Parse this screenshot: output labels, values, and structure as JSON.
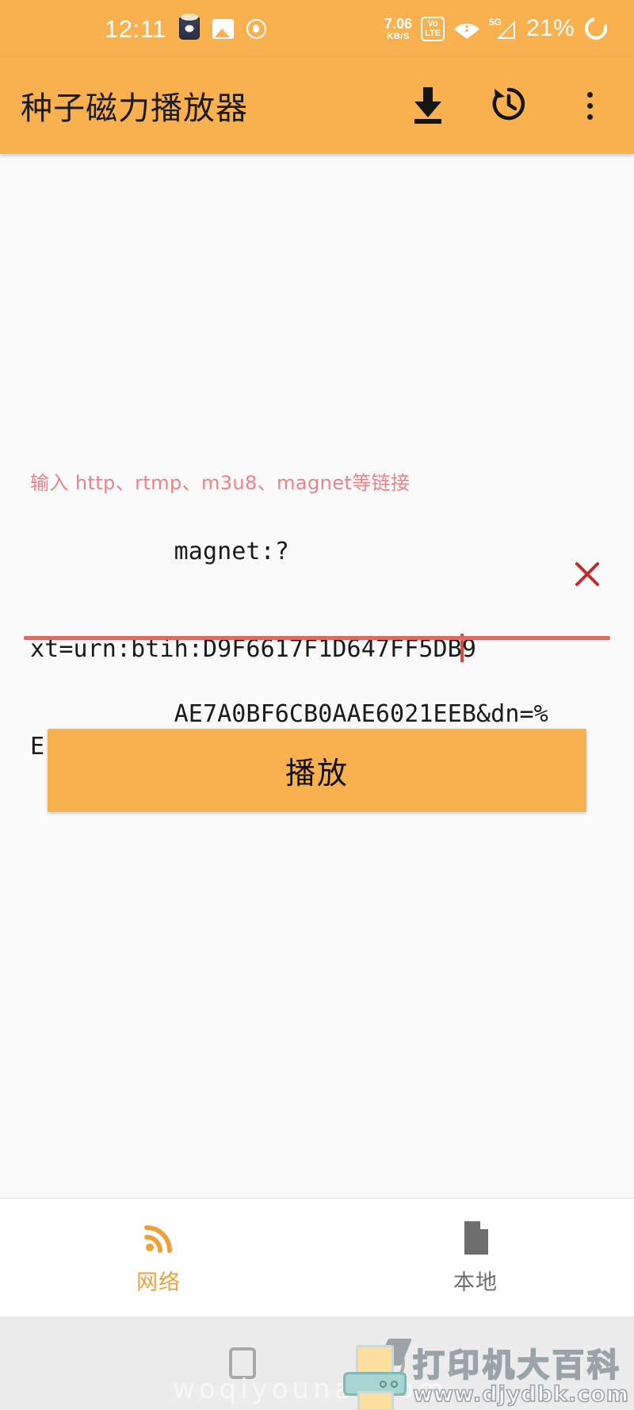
{
  "status_bar": {
    "time": "12:11",
    "network_speed_rate": "7.06",
    "network_speed_unit": "KB/S",
    "volte_top": "Vo",
    "volte_bottom": "LTE",
    "signal_label": "5G",
    "battery_percent": "21%",
    "icons": [
      "popcorn-icon",
      "gallery-icon",
      "shield-icon",
      "wifi-icon",
      "signal-icon",
      "battery-ring-icon"
    ],
    "background_color": "#F9B04E"
  },
  "app_bar": {
    "title": "种子磁力播放器",
    "background_color": "#F9B04E",
    "actions": [
      {
        "name": "download-icon"
      },
      {
        "name": "history-icon"
      },
      {
        "name": "overflow-menu-icon"
      }
    ]
  },
  "main": {
    "hint_label": "输入 http、rtmp、m3u8、magnet等链接",
    "hint_color": "#e8848a",
    "url_input": {
      "line1": "magnet:?",
      "line2_before_caret": "xt=urn:btih:D9F6617F1D647FF5DB",
      "line2_after_caret": "9",
      "line3": "AE7A0BF6CB0AAE6021EEB&dn=%E",
      "full_value": "magnet:?xt=urn:btih:D9F6617F1D647FF5DB9AE7A0BF6CB0AAE6021EEB&dn=%E",
      "placeholder": "输入 http、rtmp、m3u8、magnet等链接",
      "caret_color": "#d94b3c",
      "underline_color": "#df6a62"
    },
    "clear_icon_name": "clear-x-icon",
    "clear_icon_color": "#c42a2a",
    "play_button_label": "播放",
    "play_button_color": "#F9B04E"
  },
  "bottom_nav": {
    "items": [
      {
        "label": "网络",
        "icon": "rss-network-icon",
        "active": true,
        "color": "#EBA23C"
      },
      {
        "label": "本地",
        "icon": "document-file-icon",
        "active": false,
        "color": "#6e6e6e"
      }
    ]
  },
  "android_nav": {
    "buttons": [
      "recents-square-button",
      "home-circle-button"
    ]
  },
  "watermarks": {
    "left": "woqiyounai.com",
    "right_cn": "打印机大百科",
    "right_url": "www.djydbk.com",
    "right_logo": "printer-logo-icon"
  }
}
